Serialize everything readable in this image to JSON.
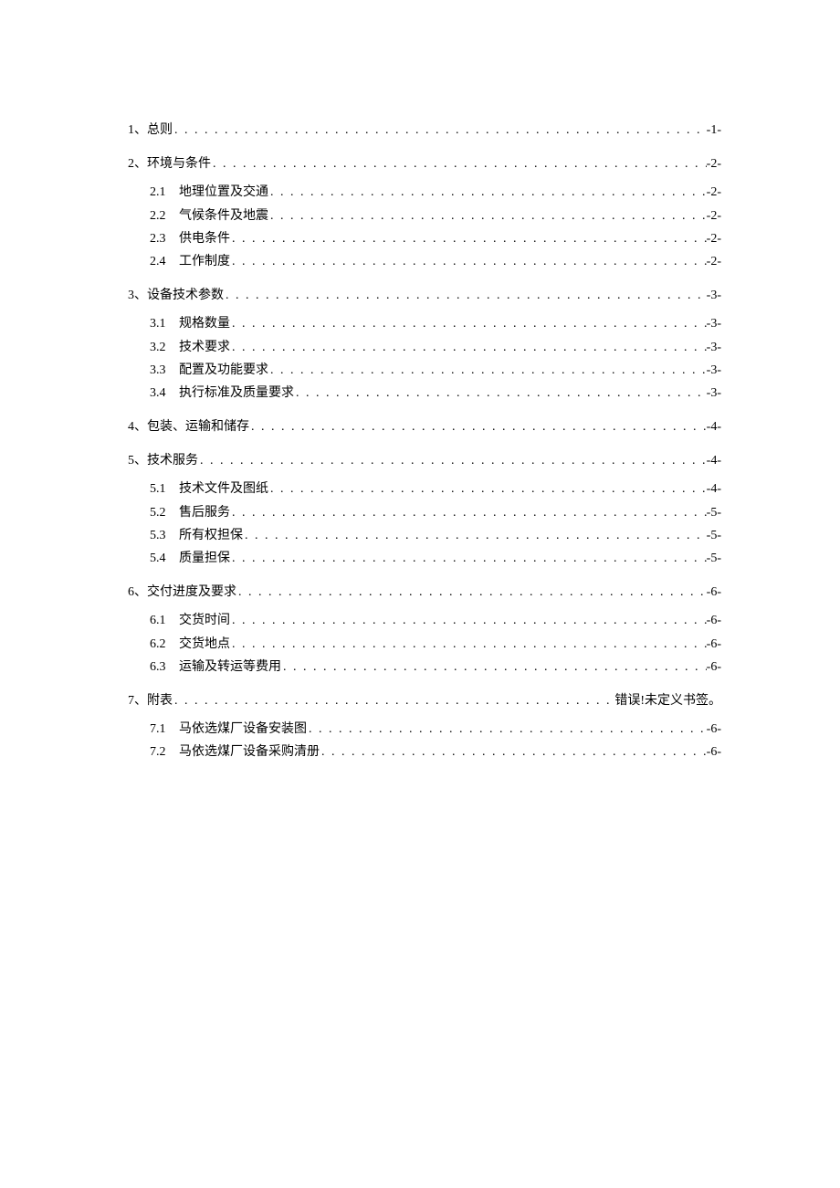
{
  "toc": [
    {
      "num": "1、",
      "title": "总则",
      "page": "-1-",
      "children": []
    },
    {
      "num": "2、",
      "title": "环境与条件",
      "page": "-2-",
      "children": [
        {
          "num": "2.1",
          "title": "地理位置及交通",
          "page": "-2-"
        },
        {
          "num": "2.2",
          "title": "气候条件及地震",
          "page": "-2-"
        },
        {
          "num": "2.3",
          "title": "供电条件",
          "page": "-2-"
        },
        {
          "num": "2.4",
          "title": "工作制度",
          "page": "-2-"
        }
      ]
    },
    {
      "num": "3、",
      "title": "设备技术参数",
      "page": "-3-",
      "children": [
        {
          "num": "3.1",
          "title": "规格数量",
          "page": "-3-"
        },
        {
          "num": "3.2",
          "title": "技术要求",
          "page": "-3-"
        },
        {
          "num": "3.3",
          "title": "配置及功能要求",
          "page": "-3-"
        },
        {
          "num": "3.4",
          "title": "执行标准及质量要求",
          "page": "-3-"
        }
      ]
    },
    {
      "num": "4、",
      "title": "包装、运输和储存",
      "page": "-4-",
      "children": []
    },
    {
      "num": "5、",
      "title": "技术服务",
      "page": "-4-",
      "children": [
        {
          "num": "5.1",
          "title": "技术文件及图纸",
          "page": "-4-"
        },
        {
          "num": "5.2",
          "title": "售后服务",
          "page": "-5-"
        },
        {
          "num": "5.3",
          "title": "所有权担保",
          "page": "-5-"
        },
        {
          "num": "5.4",
          "title": "质量担保",
          "page": "-5-"
        }
      ]
    },
    {
      "num": "6、",
      "title": "交付进度及要求",
      "page": "-6-",
      "children": [
        {
          "num": "6.1",
          "title": "交货时间",
          "page": "-6-"
        },
        {
          "num": "6.2",
          "title": "交货地点",
          "page": "-6-"
        },
        {
          "num": "6.3",
          "title": "运输及转运等费用",
          "page": "-6-"
        }
      ]
    },
    {
      "num": "7、",
      "title": "附表",
      "page": "错误!未定义书签。",
      "children": [
        {
          "num": "7.1",
          "title": "马依选煤厂设备安装图",
          "page": "-6-"
        },
        {
          "num": "7.2",
          "title": "马依选煤厂设备采购清册",
          "page": "-6-"
        }
      ]
    }
  ]
}
